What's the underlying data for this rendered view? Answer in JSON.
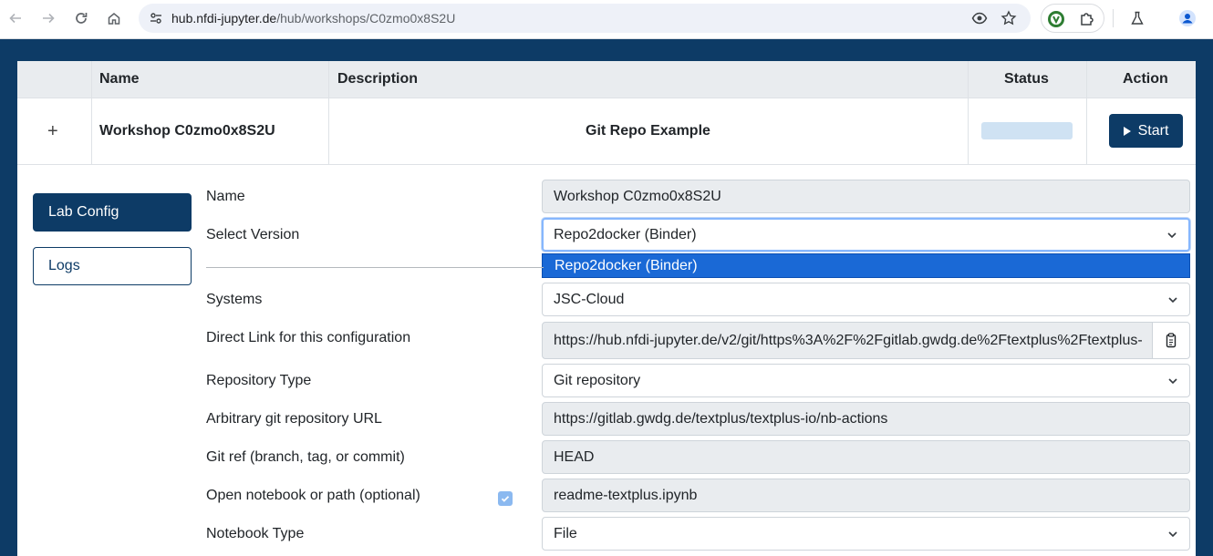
{
  "browser": {
    "url_host": "hub.nfdi-jupyter.de",
    "url_path": "/hub/workshops/C0zmo0x8S2U"
  },
  "table": {
    "headers": {
      "name": "Name",
      "description": "Description",
      "status": "Status",
      "action": "Action"
    },
    "row": {
      "expand_symbol": "+",
      "name": "Workshop C0zmo0x8S2U",
      "description": "Git Repo Example",
      "action_label": "Start"
    }
  },
  "sidebar": {
    "items": [
      {
        "label": "Lab Config",
        "active": true
      },
      {
        "label": "Logs",
        "active": false
      }
    ]
  },
  "form": {
    "name": {
      "label": "Name",
      "value": "Workshop C0zmo0x8S2U"
    },
    "version": {
      "label": "Select Version",
      "value": "Repo2docker (Binder)",
      "options": [
        "Repo2docker (Binder)"
      ]
    },
    "systems": {
      "label": "Systems",
      "value": "JSC-Cloud"
    },
    "direct_link": {
      "label": "Direct Link for this configuration",
      "value": "https://hub.nfdi-jupyter.de/v2/git/https%3A%2F%2Fgitlab.gwdg.de%2Ftextplus%2Ftextplus-"
    },
    "repo_type": {
      "label": "Repository Type",
      "value": "Git repository"
    },
    "repo_url": {
      "label": "Arbitrary git repository URL",
      "value": "https://gitlab.gwdg.de/textplus/textplus-io/nb-actions"
    },
    "git_ref": {
      "label": "Git ref (branch, tag, or commit)",
      "value": "HEAD"
    },
    "notebook_path": {
      "label": "Open notebook or path (optional)",
      "value": "readme-textplus.ipynb",
      "checked": true
    },
    "notebook_type": {
      "label": "Notebook Type",
      "value": "File"
    }
  },
  "colors": {
    "primary": "#0d3b66",
    "header_bg": "#e9ecef",
    "readonly_bg": "#e9ecef",
    "dropdown_highlight": "#1a69d6"
  }
}
